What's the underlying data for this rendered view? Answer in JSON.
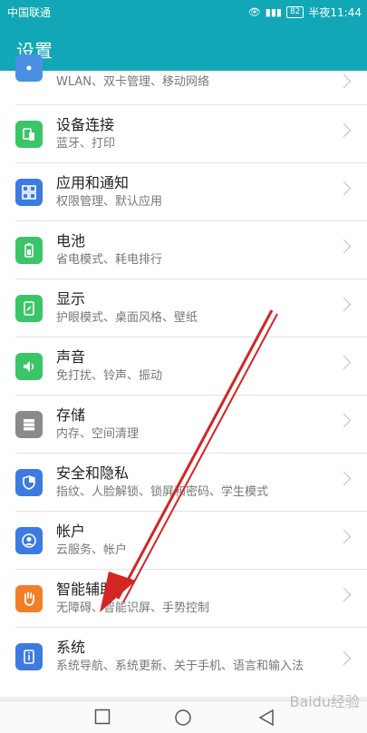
{
  "status": {
    "carrier": "中国联通",
    "battery": "82",
    "time": "半夜11:44"
  },
  "header": {
    "title": "设置"
  },
  "items": [
    {
      "title": "",
      "sub": "WLAN、双卡管理、移动网络",
      "icon": "network-icon",
      "color": "#4a90e2"
    },
    {
      "title": "设备连接",
      "sub": "蓝牙、打印",
      "icon": "device-connect-icon",
      "color": "#3cc468"
    },
    {
      "title": "应用和通知",
      "sub": "权限管理、默认应用",
      "icon": "apps-icon",
      "color": "#3d7be0"
    },
    {
      "title": "电池",
      "sub": "省电模式、耗电排行",
      "icon": "battery-icon",
      "color": "#3cc468"
    },
    {
      "title": "显示",
      "sub": "护眼模式、桌面风格、壁纸",
      "icon": "display-icon",
      "color": "#3cc468"
    },
    {
      "title": "声音",
      "sub": "免打扰、铃声、振动",
      "icon": "sound-icon",
      "color": "#3cc468"
    },
    {
      "title": "存储",
      "sub": "内存、空间清理",
      "icon": "storage-icon",
      "color": "#8a8a8a"
    },
    {
      "title": "安全和隐私",
      "sub": "指纹、人脸解锁、锁屏和密码、学生模式",
      "icon": "shield-icon",
      "color": "#3d7be0"
    },
    {
      "title": "帐户",
      "sub": "云服务、帐户",
      "icon": "account-icon",
      "color": "#3d7be0"
    },
    {
      "title": "智能辅助",
      "sub": "无障碍、智能识屏、手势控制",
      "icon": "hand-icon",
      "color": "#f07f2a"
    },
    {
      "title": "系统",
      "sub": "系统导航、系统更新、关于手机、语言和输入法",
      "icon": "system-info-icon",
      "color": "#3d7be0"
    }
  ],
  "watermark": "Baidu经验"
}
